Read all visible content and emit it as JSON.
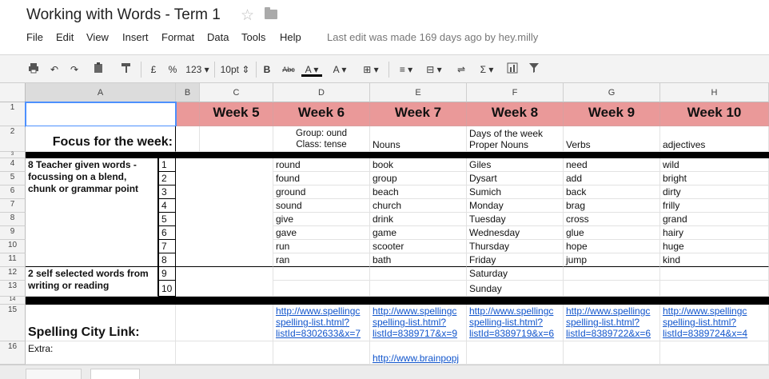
{
  "document": {
    "title": "Working with Words - Term 1",
    "star_icon": "star-icon",
    "folder_icon": "folder-icon"
  },
  "menu": {
    "items": [
      "File",
      "Edit",
      "View",
      "Insert",
      "Format",
      "Data",
      "Tools",
      "Help"
    ],
    "last_edit": "Last edit was made 169 days ago by hey.milly"
  },
  "toolbar": {
    "currency": "£",
    "percent": "%",
    "number_format": "123",
    "font_size": "10pt",
    "bold": "B",
    "strikethrough": "Abc",
    "text_color": "A",
    "fill_color": "A",
    "sigma": "Σ"
  },
  "grid": {
    "columns": [
      "A",
      "B",
      "C",
      "D",
      "E",
      "F",
      "G",
      "H"
    ],
    "rows": [
      "1",
      "2",
      "3",
      "4",
      "5",
      "6",
      "7",
      "8",
      "9",
      "10",
      "11",
      "12",
      "13",
      "14",
      "15",
      "16"
    ],
    "weeks": [
      "Week 5",
      "Week 6",
      "Week 7",
      "Week 8",
      "Week 9",
      "Week 10"
    ],
    "focus_label": "Focus for the week:",
    "focus": {
      "d": [
        "Group: ound",
        "Class: tense"
      ],
      "e": "Nouns",
      "f": [
        "Days of the week",
        "Proper Nouns"
      ],
      "g": "Verbs",
      "h": "adjectives"
    },
    "teacher_label": "8 Teacher given words - focussing on a blend, chunk or grammar point",
    "self_label": "2 self selected words from writing or reading",
    "numbers": [
      "1",
      "2",
      "3",
      "4",
      "5",
      "6",
      "7",
      "8",
      "9",
      "10"
    ],
    "words": {
      "d": [
        "round",
        "found",
        "ground",
        "sound",
        "give",
        "gave",
        "run",
        "ran"
      ],
      "e": [
        "book",
        "group",
        "beach",
        "church",
        "drink",
        "game",
        "scooter",
        "bath"
      ],
      "f": [
        "Giles",
        "Dysart",
        "Sumich",
        "Monday",
        "Tuesday",
        "Wednesday",
        "Thursday",
        "Friday",
        "Saturday",
        "Sunday"
      ],
      "g": [
        "need",
        "add",
        "back",
        "brag",
        "cross",
        "glue",
        "hope",
        "jump"
      ],
      "h": [
        "wild",
        "bright",
        "dirty",
        "frilly",
        "grand",
        "hairy",
        "huge",
        "kind"
      ]
    },
    "spelling_label": "Spelling City Link:",
    "links": {
      "d": [
        "http://www.spellingc",
        "spelling-list.html?",
        "listId=8302633&x=7"
      ],
      "e": [
        "http://www.spellingc",
        "spelling-list.html?",
        "listId=8389717&x=9"
      ],
      "f": [
        "http://www.spellingc",
        "spelling-list.html?",
        "listId=8389719&x=6"
      ],
      "g": [
        "http://www.spellingc",
        "spelling-list.html?",
        "listId=8389722&x=6"
      ],
      "h": [
        "http://www.spellingc",
        "spelling-list.html?",
        "listId=8389724&x=4"
      ]
    },
    "extra_label": "Extra:",
    "extra_link": "http://www.brainpopj"
  },
  "colors": {
    "week_header": "#ea9999",
    "link": "#1155cc",
    "selection": "#4d90fe"
  }
}
